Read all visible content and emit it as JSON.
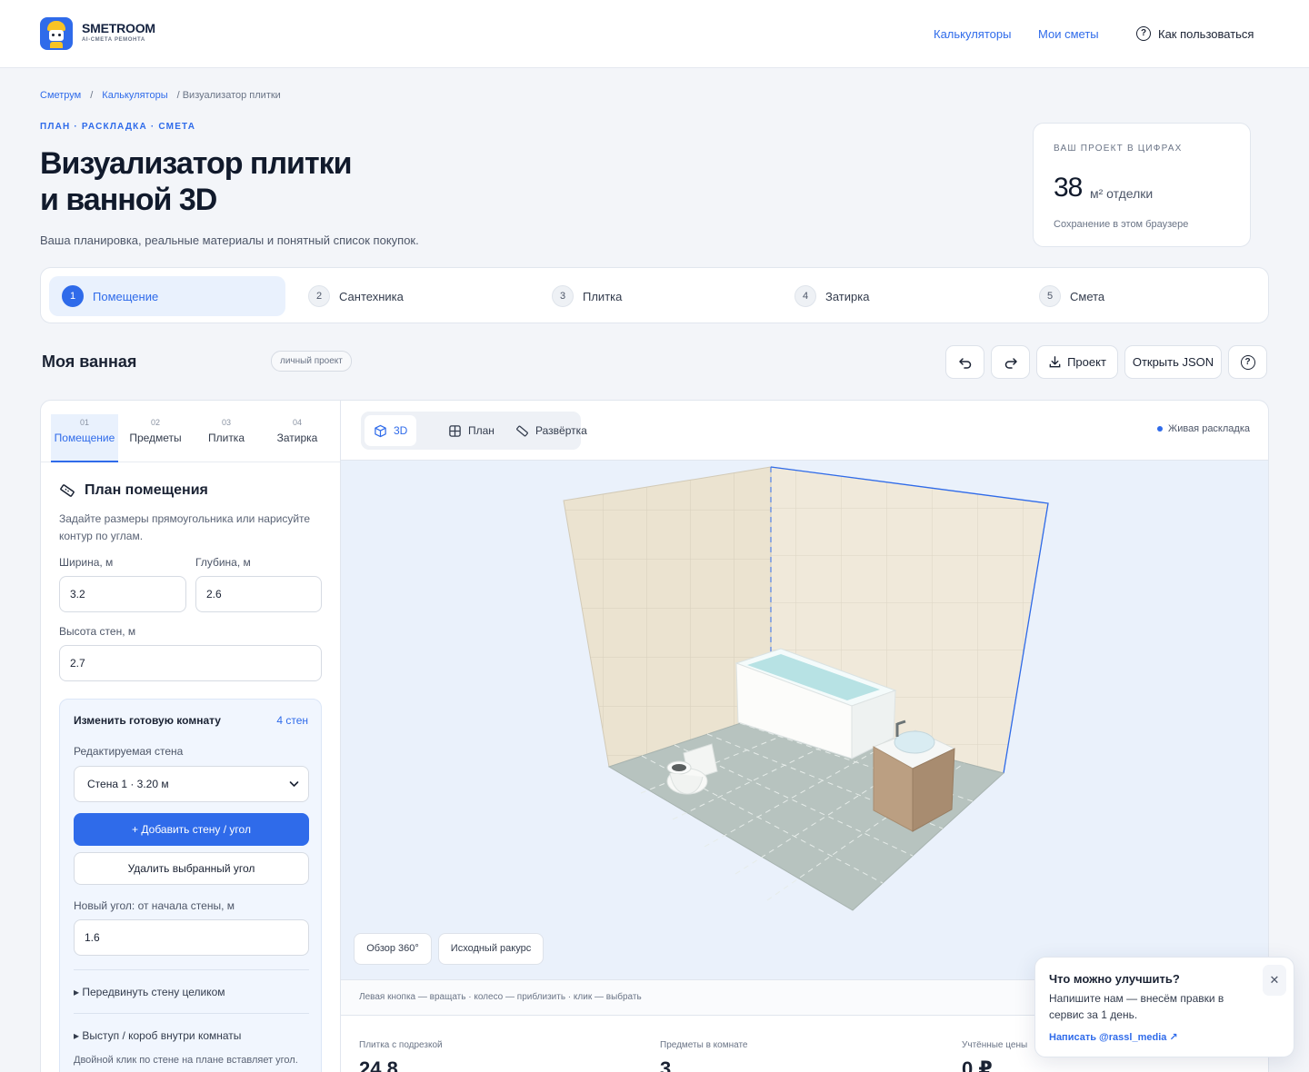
{
  "header": {
    "brand": "SMETROOM",
    "brand_sub": "AI-СМЕТА РЕМОНТА",
    "nav_calculators": "Калькуляторы",
    "nav_estimates": "Мои сметы",
    "nav_help": "Как пользоваться",
    "accent": "#2f6bea"
  },
  "breadcrumb": {
    "home": "Сметрум",
    "sep": "/",
    "calculators": "Калькуляторы",
    "current": "/ Визуализатор плитки"
  },
  "hero": {
    "kicker": "ПЛАН · РАСКЛАДКА · СМЕТА",
    "title_line1": "Визуализатор плитки",
    "title_line2": "и ванной 3D",
    "subtitle": "Ваша планировка, реальные материалы и понятный список покупок."
  },
  "stats": {
    "label": "ВАШ ПРОЕКТ В ЦИФРАХ",
    "value": "38",
    "unit": "м² отделки",
    "note": "Сохранение в этом браузере"
  },
  "steps": [
    {
      "num": "1",
      "label": "Помещение"
    },
    {
      "num": "2",
      "label": "Сантехника"
    },
    {
      "num": "3",
      "label": "Плитка"
    },
    {
      "num": "4",
      "label": "Затирка"
    },
    {
      "num": "5",
      "label": "Смета"
    }
  ],
  "project": {
    "name": "Моя ванная",
    "badge": "личный проект",
    "btn_project": "Проект",
    "btn_json": "Открыть JSON"
  },
  "left_tabs": [
    {
      "num": "01",
      "label": "Помещение"
    },
    {
      "num": "02",
      "label": "Предметы"
    },
    {
      "num": "03",
      "label": "Плитка"
    },
    {
      "num": "04",
      "label": "Затирка"
    }
  ],
  "room_panel": {
    "title": "План помещения",
    "desc": "Задайте размеры прямоугольника или нарисуйте контур по углам.",
    "width_label": "Ширина, м",
    "width_value": "3.2",
    "depth_label": "Глубина, м",
    "depth_value": "2.6",
    "height_label": "Высота стен, м",
    "height_value": "2.7"
  },
  "edit_room": {
    "title": "Изменить готовую комнату",
    "count": "4 стен",
    "wall_label": "Редактируемая стена",
    "wall_selected": "Стена 1 · 3.20 м",
    "add_btn": "+ Добавить стену / угол",
    "delete_btn": "Удалить выбранный угол",
    "new_corner_label": "Новый угол: от начала стены, м",
    "new_corner_value": "1.6",
    "move_wall": "▸ Передвинуть стену целиком",
    "box_inside": "▸ Выступ / короб внутри комнаты",
    "hint": "Двойной клик по стене на плане вставляет угол. Тяните угол или середину стены для изменения."
  },
  "viewer": {
    "tab_3d": "3D",
    "tab_plan": "План",
    "tab_unfold": "Развёртка",
    "live": "Живая раскладка",
    "btn_orbit": "Обзор 360°",
    "btn_reset": "Исходный ракурс",
    "hint": "Левая кнопка — вращать · колесо — приблизить · клик — выбрать"
  },
  "metrics": [
    {
      "label": "Плитка с подрезкой",
      "value": "24.8"
    },
    {
      "label": "Предметы в комнате",
      "value": "3"
    },
    {
      "label": "Учтённые цены",
      "value": "0 ₽"
    }
  ],
  "toast": {
    "title": "Что можно улучшить?",
    "body": "Напишите нам — внесём правки в сервис за 1 день.",
    "link": "Написать @rassl_media ↗"
  }
}
